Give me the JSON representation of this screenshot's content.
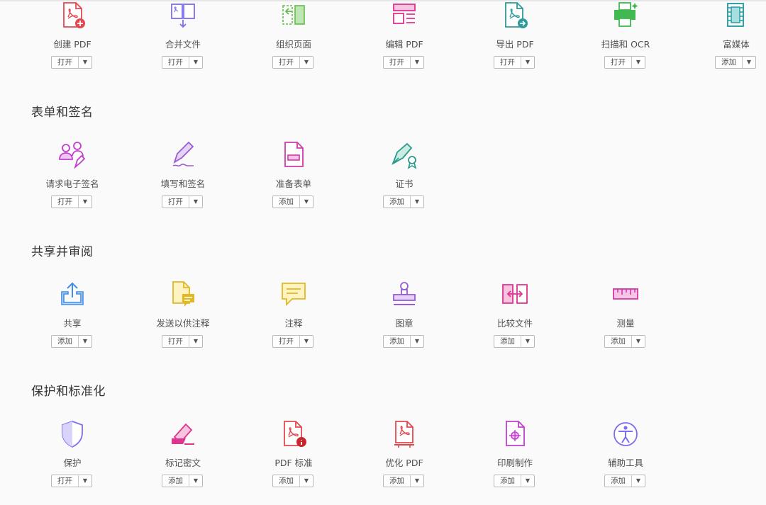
{
  "sections": [
    {
      "title": "",
      "tools": [
        {
          "label": "创建 PDF",
          "button": "打开",
          "icon": "create-pdf-icon",
          "color": "#e34850"
        },
        {
          "label": "合并文件",
          "button": "打开",
          "icon": "combine-files-icon",
          "color": "#7c6ef0"
        },
        {
          "label": "组织页面",
          "button": "打开",
          "icon": "organize-pages-icon",
          "color": "#5fbf4a"
        },
        {
          "label": "编辑 PDF",
          "button": "打开",
          "icon": "edit-pdf-icon",
          "color": "#e0338f"
        },
        {
          "label": "导出 PDF",
          "button": "打开",
          "icon": "export-pdf-icon",
          "color": "#2f9a9a"
        },
        {
          "label": "扫描和 OCR",
          "button": "打开",
          "icon": "scan-ocr-icon",
          "color": "#3fb950"
        },
        {
          "label": "富媒体",
          "button": "添加",
          "icon": "rich-media-icon",
          "color": "#1a9aa0"
        }
      ]
    },
    {
      "title": "表单和签名",
      "tools": [
        {
          "label": "请求电子签名",
          "button": "打开",
          "icon": "request-esign-icon",
          "color": "#c23ecf"
        },
        {
          "label": "填写和签名",
          "button": "打开",
          "icon": "fill-sign-icon",
          "color": "#9a5bd6"
        },
        {
          "label": "准备表单",
          "button": "添加",
          "icon": "prepare-form-icon",
          "color": "#d23aa6"
        },
        {
          "label": "证书",
          "button": "添加",
          "icon": "certificate-icon",
          "color": "#2a9a8a"
        }
      ]
    },
    {
      "title": "共享并审阅",
      "tools": [
        {
          "label": "共享",
          "button": "添加",
          "icon": "share-icon",
          "color": "#3f8ee6"
        },
        {
          "label": "发送以供注释",
          "button": "打开",
          "icon": "send-comment-icon",
          "color": "#e2b824"
        },
        {
          "label": "注释",
          "button": "打开",
          "icon": "comment-icon",
          "color": "#e2b824"
        },
        {
          "label": "图章",
          "button": "添加",
          "icon": "stamp-icon",
          "color": "#9a5bd6"
        },
        {
          "label": "比较文件",
          "button": "添加",
          "icon": "compare-files-icon",
          "color": "#e0338f"
        },
        {
          "label": "测量",
          "button": "添加",
          "icon": "measure-icon",
          "color": "#d23aa6"
        }
      ]
    },
    {
      "title": "保护和标准化",
      "tools": [
        {
          "label": "保护",
          "button": "打开",
          "icon": "protect-icon",
          "color": "#7c6ef0"
        },
        {
          "label": "标记密文",
          "button": "添加",
          "icon": "redact-icon",
          "color": "#e0338f"
        },
        {
          "label": "PDF 标准",
          "button": "添加",
          "icon": "pdf-standards-icon",
          "color": "#e34850"
        },
        {
          "label": "优化 PDF",
          "button": "添加",
          "icon": "optimize-pdf-icon",
          "color": "#e34850"
        },
        {
          "label": "印刷制作",
          "button": "添加",
          "icon": "print-production-icon",
          "color": "#c23ecf"
        },
        {
          "label": "辅助工具",
          "button": "添加",
          "icon": "accessibility-icon",
          "color": "#7c6ef0"
        }
      ]
    }
  ]
}
